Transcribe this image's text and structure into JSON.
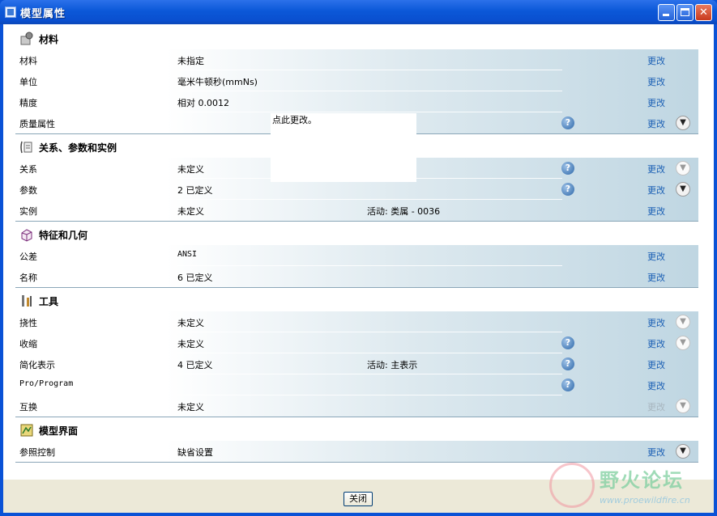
{
  "window": {
    "title": "模型属性"
  },
  "callout": {
    "text": "点此更改。"
  },
  "footer": {
    "close_label": "关闭"
  },
  "watermark": {
    "text": "野火论坛",
    "url": "www.proewildfire.cn"
  },
  "sections": [
    {
      "title": "材料",
      "icon": "material-icon",
      "rows": [
        {
          "label": "材料",
          "value": "未指定",
          "extra": "",
          "help": false,
          "change": "更改",
          "change_enabled": true,
          "expand": "none"
        },
        {
          "label": "单位",
          "value": "毫米牛顿秒(mmNs)",
          "extra": "",
          "help": false,
          "change": "更改",
          "change_enabled": true,
          "expand": "none"
        },
        {
          "label": "精度",
          "value": "相对 0.0012",
          "extra": "",
          "help": false,
          "change": "更改",
          "change_enabled": true,
          "expand": "none"
        },
        {
          "label": "质量属性",
          "value": "",
          "extra": "",
          "help": true,
          "change": "更改",
          "change_enabled": true,
          "expand": "active"
        }
      ]
    },
    {
      "title": "关系、参数和实例",
      "icon": "relations-icon",
      "rows": [
        {
          "label": "关系",
          "value": "未定义",
          "extra": "",
          "help": true,
          "change": "更改",
          "change_enabled": true,
          "expand": "dim"
        },
        {
          "label": "参数",
          "value": "2 已定义",
          "extra": "",
          "help": true,
          "change": "更改",
          "change_enabled": true,
          "expand": "active"
        },
        {
          "label": "实例",
          "value": "未定义",
          "extra": "活动: 类属 - 0036",
          "help": false,
          "change": "更改",
          "change_enabled": true,
          "expand": "none"
        }
      ]
    },
    {
      "title": "特征和几何",
      "icon": "features-icon",
      "rows": [
        {
          "label": "公差",
          "value": "ANSI",
          "extra": "",
          "help": false,
          "change": "更改",
          "change_enabled": true,
          "expand": "none"
        },
        {
          "label": "名称",
          "value": "6 已定义",
          "extra": "",
          "help": false,
          "change": "更改",
          "change_enabled": true,
          "expand": "none"
        }
      ]
    },
    {
      "title": "工具",
      "icon": "tools-icon",
      "rows": [
        {
          "label": "挠性",
          "value": "未定义",
          "extra": "",
          "help": false,
          "change": "更改",
          "change_enabled": true,
          "expand": "dim"
        },
        {
          "label": "收缩",
          "value": "未定义",
          "extra": "",
          "help": true,
          "change": "更改",
          "change_enabled": true,
          "expand": "dim"
        },
        {
          "label": "简化表示",
          "value": "4 已定义",
          "extra": "活动: 主表示",
          "help": true,
          "change": "更改",
          "change_enabled": true,
          "expand": "none"
        },
        {
          "label": "Pro/Program",
          "value": "",
          "extra": "",
          "help": true,
          "change": "更改",
          "change_enabled": true,
          "expand": "none"
        },
        {
          "label": "互换",
          "value": "未定义",
          "extra": "",
          "help": false,
          "change": "更改",
          "change_enabled": false,
          "expand": "dim"
        }
      ]
    },
    {
      "title": "模型界面",
      "icon": "model-interface-icon",
      "rows": [
        {
          "label": "参照控制",
          "value": "缺省设置",
          "extra": "",
          "help": false,
          "change": "更改",
          "change_enabled": true,
          "expand": "active"
        }
      ]
    }
  ]
}
